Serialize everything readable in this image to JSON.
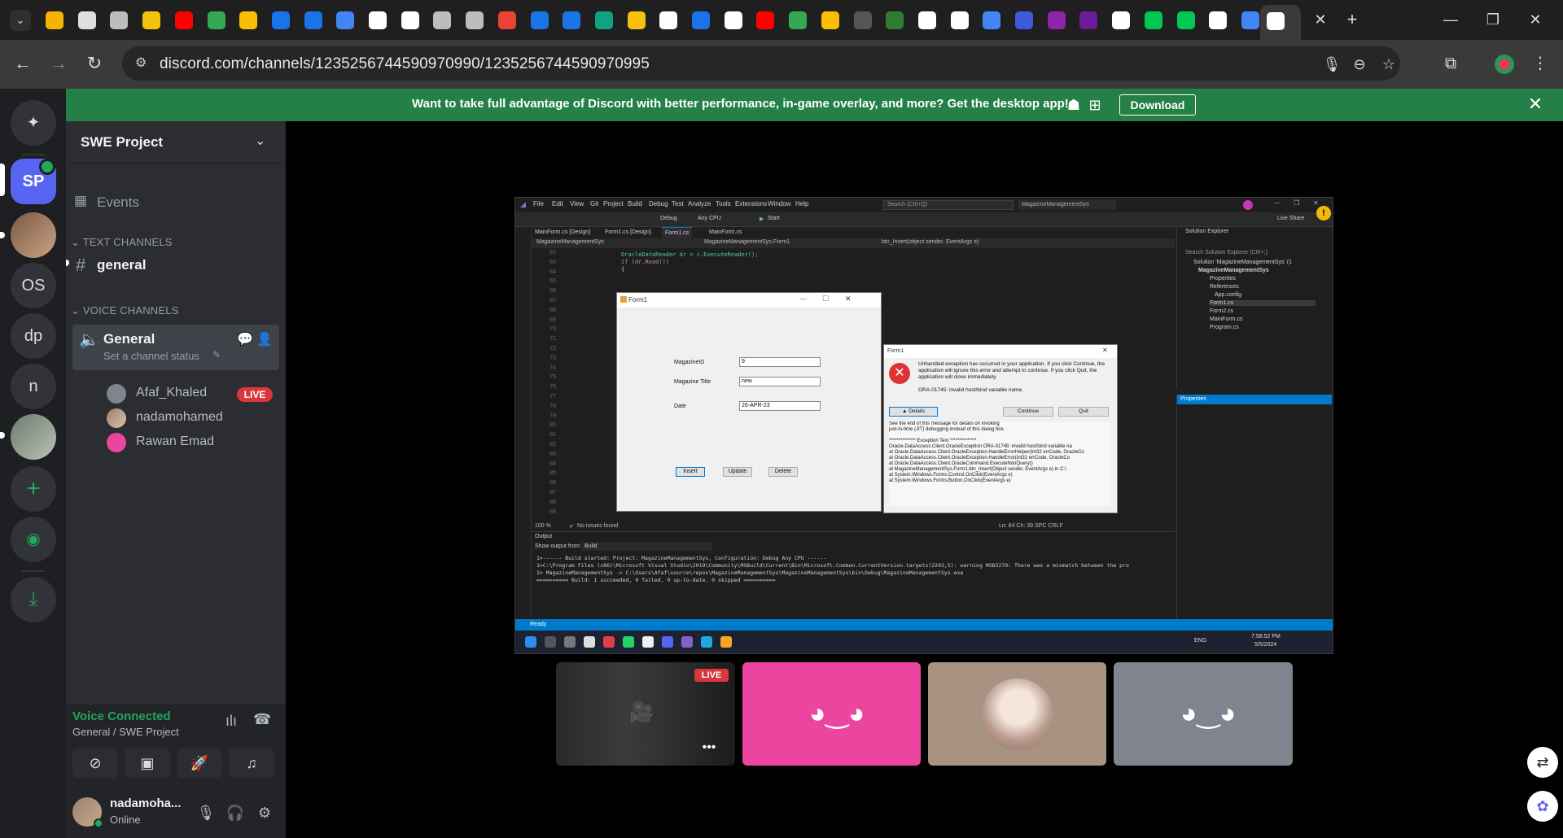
{
  "browser": {
    "url": "discord.com/channels/1235256744590970990/1235256744590970995",
    "tab_close": "✕",
    "new_tab": "+",
    "win_minimize": "—",
    "win_restore": "❐",
    "win_close": "✕"
  },
  "favicon_colors": [
    "#f4b400",
    "#e0e0e0",
    "#bdbdbd",
    "#f4c20d",
    "#ff0000",
    "#34a853",
    "#fbbc05",
    "#1a73e8",
    "#1a73e8",
    "#4285f4",
    "#ffffff",
    "#ffffff",
    "#bdbdbd",
    "#bdbdbd",
    "#ea4335",
    "#1a73e8",
    "#1a73e8",
    "#10a37f",
    "#f4c20d",
    "#ffffff",
    "#1a73e8",
    "#ffffff",
    "#ff0000",
    "#34a853",
    "#fbbc05",
    "#555555",
    "#2e7d32",
    "#ffffff",
    "#ffffff",
    "#4285f4",
    "#3b5bdb",
    "#8e24aa",
    "#6a1b9a",
    "#ffffff",
    "#00c853",
    "#00c853",
    "#ffffff",
    "#4285f4"
  ],
  "banner": {
    "text": "Want to take full advantage of Discord with better performance, in-game overlay, and more? Get the desktop app!",
    "download": "Download"
  },
  "rail": {
    "servers": [
      {
        "label": "SP"
      },
      {
        "label": "OS"
      },
      {
        "label": "dp"
      },
      {
        "label": "n"
      }
    ]
  },
  "guild": {
    "name": "SWE Project",
    "events": "Events",
    "text_category": "TEXT CHANNELS",
    "text_channel": "general",
    "voice_category": "VOICE CHANNELS",
    "voice_channel": "General",
    "voice_status": "Set a channel status",
    "users": [
      {
        "name": "Afaf_Khaled",
        "live": "LIVE",
        "color": "#80848e"
      },
      {
        "name": "nadamohamed",
        "color": "#b08c78"
      },
      {
        "name": "Rawan Emad",
        "color": "#eb459f"
      }
    ]
  },
  "voice_panel": {
    "status": "Voice Connected",
    "location": "General / SWE Project"
  },
  "user_panel": {
    "name": "nadamoha...",
    "status": "Online"
  },
  "vs": {
    "menu": [
      "File",
      "Edit",
      "View",
      "Git",
      "Project",
      "Build",
      "Debug",
      "Test",
      "Analyze",
      "Tools",
      "Extensions",
      "Window",
      "Help"
    ],
    "search": "Search (Ctrl+Q)",
    "project": "MagazineManagementSys",
    "live_share": "Live Share",
    "toolbar": [
      "Debug",
      "Any CPU",
      "Start"
    ],
    "tabs": [
      "MainForm.cs [Design]",
      "Form1.cs [Design]",
      "Form1.cs",
      "MainForm.cs"
    ],
    "nav_left": "MagazineManagementSys",
    "nav_mid": "MagazineManagementSys.Form1",
    "nav_right": "btn_Insert(object sender, EventArgs e)",
    "line_numbers": [
      "62",
      "63",
      "64",
      "65",
      "66",
      "67",
      "68",
      "69",
      "70",
      "71",
      "72",
      "73",
      "74",
      "75",
      "76",
      "77",
      "78",
      "79",
      "80",
      "81",
      "82",
      "83",
      "84",
      "85",
      "86",
      "87",
      "88",
      "89"
    ],
    "code_lines": [
      "OracleDataReader dr = c.ExecuteReader();",
      "if (dr.Read())",
      "{"
    ],
    "status_zoom": "100 %",
    "status_issues": "No issues found",
    "status_pos": "Ln: 84   Ch: 39   SPC   CRLF",
    "output_title": "Output",
    "output_from": "Show output from:",
    "output_source": "Build",
    "output_lines": [
      "1>------ Build started: Project: MagazineManagementSys, Configuration: Debug Any CPU ------",
      "1>C:\\Program Files (x86)\\Microsoft Visual Studio\\2019\\Community\\MSBuild\\Current\\Bin\\Microsoft.Common.CurrentVersion.targets(2203,5): warning MSB3270: There was a mismatch between the pro",
      "1>  MagazineManagementSys -> C:\\Users\\Afaf\\source\\repos\\MagazineManagementSys\\MagazineManagementSys\\bin\\Debug\\MagazineManagementSys.exe",
      "========== Build: 1 succeeded, 0 failed, 0 up-to-date, 0 skipped =========="
    ],
    "solution_title": "Solution Explorer",
    "solution_search": "Search Solution Explorer (Ctrl+;)",
    "solution_items": [
      "Solution 'MagazineManagementSys' (1",
      "MagazineManagementSys",
      "Properties",
      "References",
      "App.config",
      "Form1.cs",
      "Form2.cs",
      "MainForm.cs",
      "Program.cs"
    ],
    "properties_title": "Properties",
    "statusbar": "Ready",
    "taskbar_lang": "ENG",
    "taskbar_time": "7:58:52 PM",
    "taskbar_date": "5/5/2024"
  },
  "form1": {
    "title": "Form1",
    "labels": [
      "MagazineID",
      "Magazine Title",
      "Date"
    ],
    "values": [
      "9",
      "new",
      "26-APR-23"
    ],
    "buttons": [
      "Insert",
      "Update",
      "Delete"
    ]
  },
  "error": {
    "title": "Form1",
    "message": "Unhandled exception has occurred in your application. If you click Continue, the application will ignore this error and attempt to continue. If you click Quit, the application will close immediately.",
    "ora": "ORA-01745: invalid host/bind variable name.",
    "details_btn": "Details",
    "continue_btn": "Continue",
    "quit_btn": "Quit",
    "detail_lines": [
      "See the end of this message for details on invoking",
      "just-in-time (JIT) debugging instead of this dialog box.",
      "",
      "************** Exception Text **************",
      "Oracle.DataAccess.Client.OracleException ORA-01745: invalid host/bind variable na",
      "   at Oracle.DataAccess.Client.OracleException.HandleErrorHelper(Int32 errCode, OracleCo",
      "   at Oracle.DataAccess.Client.OracleException.HandleError(Int32 errCode, OracleCo",
      "   at Oracle.DataAccess.Client.OracleCommand.ExecuteNonQuery()",
      "   at MagazineManagementSys.Form1.btn_Insert(Object sender, EventArgs e) in C:\\",
      "   at System.Windows.Forms.Control.OnClick(EventArgs e)",
      "   at System.Windows.Forms.Button.OnClick(EventArgs e)"
    ]
  },
  "tiles": {
    "live": "LIVE",
    "more": "•••"
  }
}
